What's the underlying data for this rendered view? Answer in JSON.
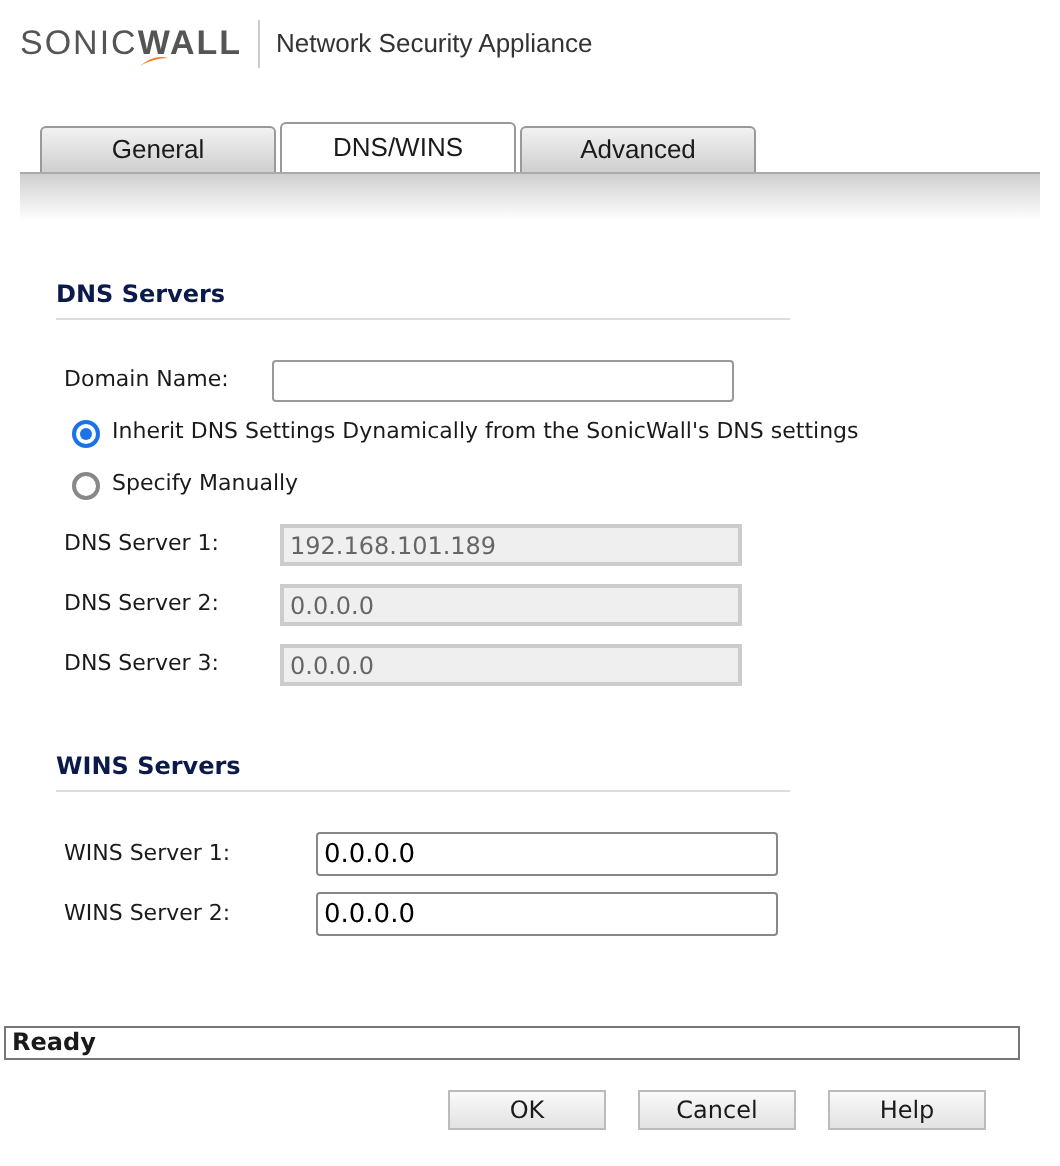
{
  "header": {
    "logo": "SONIC**WALL**",
    "title": "Network Security Appliance"
  },
  "tabs": [
    {
      "label": "General",
      "selected": false
    },
    {
      "label": "DNS/WINS",
      "selected": true
    },
    {
      "label": "Advanced",
      "selected": false
    }
  ],
  "dns_servers": {
    "heading": "DNS Servers",
    "domain_name": {
      "label": "Domain Name:"
    },
    "options": [
      {
        "label": "Inherit DNS Settings Dynamically from the SonicWall's DNS settings",
        "selected": true
      },
      {
        "label": "Specify Manually",
        "selected": false
      }
    ],
    "servers": [
      {
        "label": "DNS Server 1:",
        "value": "192.168.101.189",
        "disabled": true
      },
      {
        "label": "DNS Server 2:",
        "value": "0.0.0.0",
        "disabled": true
      },
      {
        "label": "DNS Server 3:",
        "value": "0.0.0.0",
        "disabled": true
      }
    ]
  },
  "wins_servers": {
    "heading": "WINS Servers",
    "servers": [
      {
        "label": "WINS Server 1:",
        "value": "0.0.0.0"
      },
      {
        "label": "WINS Server 2:",
        "value": "0.0.0.0"
      }
    ]
  },
  "status_bar": "Ready",
  "buttons": [
    "OK",
    "Cancel",
    "Help"
  ]
}
